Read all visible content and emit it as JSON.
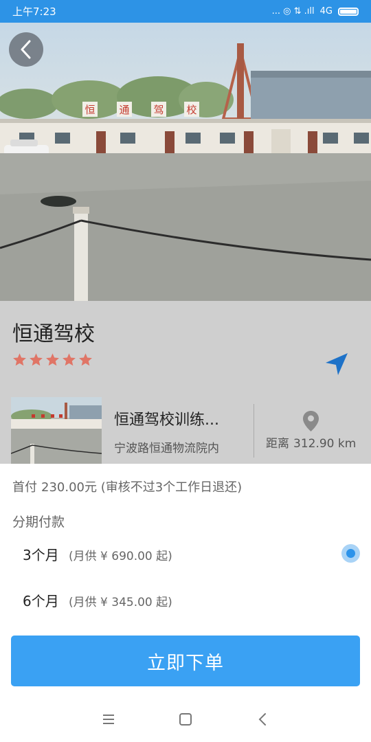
{
  "status_bar": {
    "time": "上午7:23",
    "indicators": "... ◎ ⇅ .ıll",
    "network": "4G"
  },
  "school": {
    "name": "恒通驾校",
    "rating": 5,
    "star_color": "#e07566"
  },
  "venue": {
    "name": "恒通驾校训练...",
    "address": "宁波路恒通物流院内",
    "distance_label": "距离",
    "distance_value": "312.90 km"
  },
  "payment": {
    "down_payment_label": "首付",
    "down_payment_text": "230.00元 (审核不过3个工作日退还)",
    "installment_label": "分期付款",
    "options": [
      {
        "period": "3个月",
        "monthly": "(月供 ¥ 690.00 起)",
        "selected": true
      },
      {
        "period": "6个月",
        "monthly": "(月供 ¥ 345.00 起)",
        "selected": false
      }
    ]
  },
  "actions": {
    "order_button": "立即下单"
  },
  "colors": {
    "status_bar": "#2d93e6",
    "accent": "#3aa1f3",
    "navigate_arrow": "#1e72c8"
  }
}
